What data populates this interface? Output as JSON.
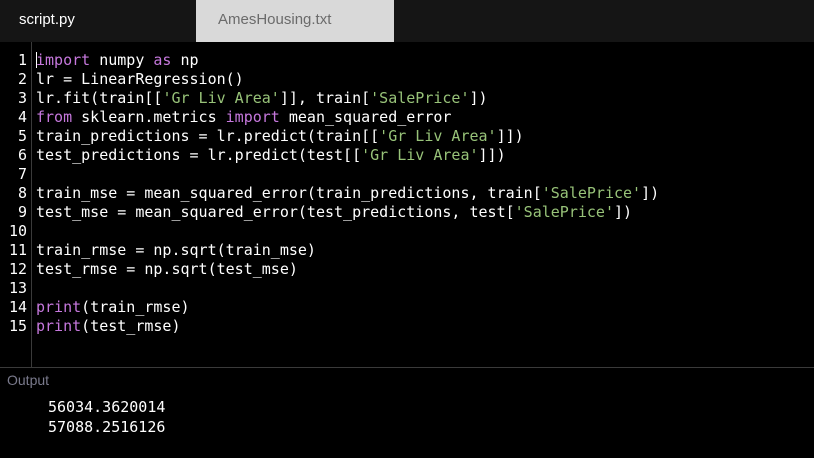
{
  "tabs": [
    {
      "label": "script.py",
      "active": true
    },
    {
      "label": "AmesHousing.txt",
      "active": false
    }
  ],
  "colors": {
    "keyword": "#c678dd",
    "string": "#98c379",
    "text": "#ffffff",
    "background": "#000000",
    "inactive_tab": "#d9d9d9"
  },
  "editor": {
    "lines": [
      {
        "number": "1",
        "tokens": [
          {
            "t": "kw",
            "v": "import"
          },
          {
            "t": "plain",
            "v": " numpy "
          },
          {
            "t": "kw",
            "v": "as"
          },
          {
            "t": "plain",
            "v": " np"
          }
        ]
      },
      {
        "number": "2",
        "tokens": [
          {
            "t": "plain",
            "v": "lr = LinearRegression()"
          }
        ]
      },
      {
        "number": "3",
        "tokens": [
          {
            "t": "plain",
            "v": "lr.fit(train[["
          },
          {
            "t": "str",
            "v": "'Gr Liv Area'"
          },
          {
            "t": "plain",
            "v": "]], train["
          },
          {
            "t": "str",
            "v": "'SalePrice'"
          },
          {
            "t": "plain",
            "v": "])"
          }
        ]
      },
      {
        "number": "4",
        "tokens": [
          {
            "t": "kw",
            "v": "from"
          },
          {
            "t": "plain",
            "v": " sklearn.metrics "
          },
          {
            "t": "kw",
            "v": "import"
          },
          {
            "t": "plain",
            "v": " mean_squared_error"
          }
        ]
      },
      {
        "number": "5",
        "tokens": [
          {
            "t": "plain",
            "v": "train_predictions = lr.predict(train[["
          },
          {
            "t": "str",
            "v": "'Gr Liv Area'"
          },
          {
            "t": "plain",
            "v": "]])"
          }
        ]
      },
      {
        "number": "6",
        "tokens": [
          {
            "t": "plain",
            "v": "test_predictions = lr.predict(test[["
          },
          {
            "t": "str",
            "v": "'Gr Liv Area'"
          },
          {
            "t": "plain",
            "v": "]])"
          }
        ]
      },
      {
        "number": "7",
        "tokens": []
      },
      {
        "number": "8",
        "tokens": [
          {
            "t": "plain",
            "v": "train_mse = mean_squared_error(train_predictions, train["
          },
          {
            "t": "str",
            "v": "'SalePrice'"
          },
          {
            "t": "plain",
            "v": "])"
          }
        ]
      },
      {
        "number": "9",
        "tokens": [
          {
            "t": "plain",
            "v": "test_mse = mean_squared_error(test_predictions, test["
          },
          {
            "t": "str",
            "v": "'SalePrice'"
          },
          {
            "t": "plain",
            "v": "])"
          }
        ]
      },
      {
        "number": "10",
        "tokens": []
      },
      {
        "number": "11",
        "tokens": [
          {
            "t": "plain",
            "v": "train_rmse = np.sqrt(train_mse)"
          }
        ]
      },
      {
        "number": "12",
        "tokens": [
          {
            "t": "plain",
            "v": "test_rmse = np.sqrt(test_mse)"
          }
        ]
      },
      {
        "number": "13",
        "tokens": []
      },
      {
        "number": "14",
        "tokens": [
          {
            "t": "kw",
            "v": "print"
          },
          {
            "t": "plain",
            "v": "(train_rmse)"
          }
        ]
      },
      {
        "number": "15",
        "tokens": [
          {
            "t": "kw",
            "v": "print"
          },
          {
            "t": "plain",
            "v": "(test_rmse)"
          }
        ]
      }
    ]
  },
  "output": {
    "label": "Output",
    "lines": [
      "56034.3620014",
      "57088.2516126"
    ]
  }
}
